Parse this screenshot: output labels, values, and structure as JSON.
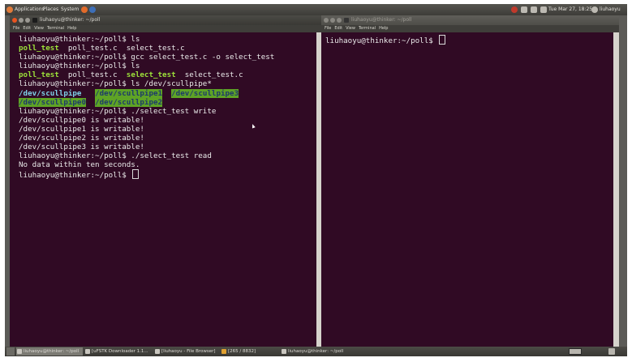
{
  "top_panel": {
    "menus": [
      "Applications",
      "Places",
      "System"
    ],
    "clock": "Tue Mar 27, 18:25",
    "user": "liuhaoyu"
  },
  "left_window": {
    "title": "liuhaoyu@thinker: ~/poll",
    "menu": [
      "File",
      "Edit",
      "View",
      "Terminal",
      "Help"
    ],
    "lines": [
      [
        {
          "t": "liuhaoyu@thinker:~/poll$ ls"
        }
      ],
      [
        {
          "t": "poll_test",
          "c": "g"
        },
        {
          "t": "  poll_test.c  select_test.c"
        }
      ],
      [
        {
          "t": "liuhaoyu@thinker:~/poll$ gcc select_test.c -o select_test"
        }
      ],
      [
        {
          "t": "liuhaoyu@thinker:~/poll$ ls"
        }
      ],
      [
        {
          "t": "poll_test",
          "c": "g"
        },
        {
          "t": "  poll_test.c  "
        },
        {
          "t": "select_test",
          "c": "g"
        },
        {
          "t": "  select_test.c"
        }
      ],
      [
        {
          "t": "liuhaoyu@thinker:~/poll$ ls /dev/scullpipe*"
        }
      ],
      [
        {
          "t": "/dev/scullpipe",
          "c": "c"
        },
        {
          "t": "   "
        },
        {
          "t": "/dev/scullpipe1",
          "c": "hl"
        },
        {
          "t": "  "
        },
        {
          "t": "/dev/scullpipe3",
          "c": "hl"
        }
      ],
      [
        {
          "t": "/dev/scullpipe0",
          "c": "hl"
        },
        {
          "t": "  "
        },
        {
          "t": "/dev/scullpipe2",
          "c": "hl"
        }
      ],
      [
        {
          "t": "liuhaoyu@thinker:~/poll$ ./select_test write"
        }
      ],
      [
        {
          "t": "/dev/scullpipe0 is writable!"
        }
      ],
      [
        {
          "t": "/dev/scullpipe1 is writable!"
        }
      ],
      [
        {
          "t": "/dev/scullpipe2 is writable!"
        }
      ],
      [
        {
          "t": "/dev/scullpipe3 is writable!"
        }
      ],
      [
        {
          "t": "liuhaoyu@thinker:~/poll$ ./select_test read"
        }
      ],
      [
        {
          "t": "No data within ten seconds."
        }
      ],
      [
        {
          "t": "liuhaoyu@thinker:~/poll$ "
        }
      ]
    ]
  },
  "right_window": {
    "title": "liuhaoyu@thinker: ~/poll",
    "menu": [
      "File",
      "Edit",
      "View",
      "Terminal",
      "Help"
    ],
    "lines": [
      [
        {
          "t": "liuhaoyu@thinker:~/poll$ "
        }
      ]
    ]
  },
  "taskbar": {
    "tasks": [
      "liuhaoyu@thinker: ~/poll",
      "[uFSTK Downloader 1.1...",
      "[liuhaoyu - File Browser]",
      "[265 / 8832]",
      "liuhaoyu@thinker: ~/poll"
    ]
  },
  "colors": {
    "terminal_bg": "#300a24",
    "executable": "#9ce03a",
    "fifo_highlight": "#5ea325",
    "dir_cyan": "#7fd0e8"
  }
}
